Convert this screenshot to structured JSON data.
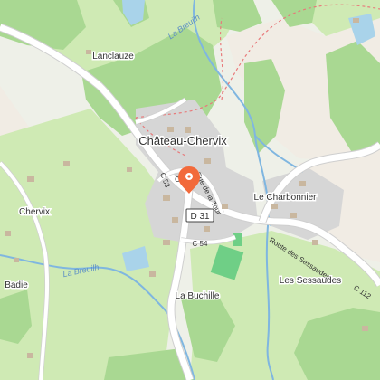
{
  "map": {
    "colors": {
      "background": "#eef0e8",
      "meadow": "#cfeab4",
      "forest": "#a9d892",
      "bare": "#f1ece4",
      "water": "#a9d3ea",
      "river": "#7fb6e0",
      "road": "#ffffff",
      "road_edge": "#cfcfcf",
      "built": "#d6d6d6",
      "building": "#c9b79f",
      "sport": "#6fcf86",
      "trail": "#e8797a",
      "marker": "#f26a3b",
      "label_text": "#333333",
      "river_text": "#5d8fc5",
      "shield_border": "#444444"
    },
    "marker": {
      "name": "map-pin",
      "icon": "location-pin-icon"
    },
    "places": {
      "village_main": "Château-Chervix",
      "lanclauze": "Lanclauze",
      "chervix": "Chervix",
      "le_charbonnier": "Le Charbonnier",
      "la_buchille": "La Buchille",
      "les_sessaudes": "Les Sessaudes",
      "badie": "Badie"
    },
    "rivers": {
      "north": "La Breuilh",
      "south": "La Breuilh"
    },
    "roads": {
      "d31_shield": "D 31",
      "c54": "C 54",
      "route_sessaudes": "Route des Sessaudes",
      "c112": "C 112",
      "rue_tour": "Rue de la Tour",
      "c53": "C 53",
      "c_fragment": "C"
    }
  }
}
